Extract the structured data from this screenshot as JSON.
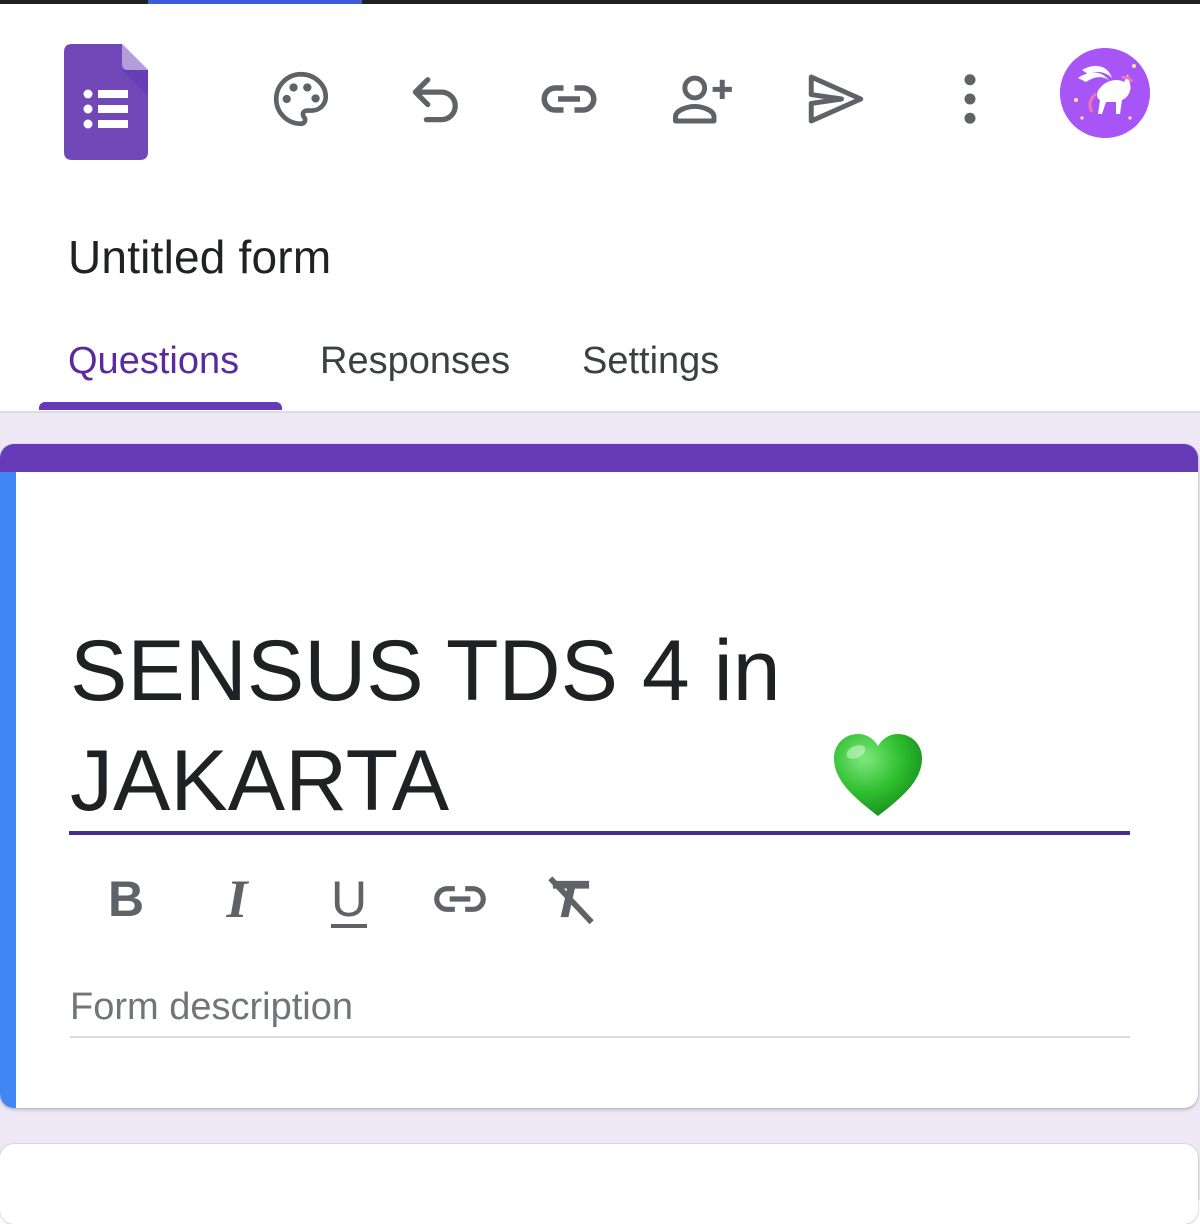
{
  "app": {
    "name": "Google Forms",
    "logo_icon": "google-forms-logo-icon",
    "colors": {
      "theme": "#673ab7",
      "accent": "#4285f4",
      "background": "#ede7f6",
      "active_tab_text": "#5b2a9e",
      "avatar_bg": "#a855f7"
    }
  },
  "toolbar": {
    "buttons": [
      {
        "name": "customize-theme",
        "icon": "palette-icon"
      },
      {
        "name": "undo",
        "icon": "undo-icon"
      },
      {
        "name": "copy-link",
        "icon": "link-icon"
      },
      {
        "name": "add-collaborators",
        "icon": "person-add-icon"
      },
      {
        "name": "send",
        "icon": "send-icon"
      },
      {
        "name": "more-options",
        "icon": "more-vert-icon"
      }
    ],
    "avatar_icon": "pegasus-avatar-icon"
  },
  "form": {
    "document_title": "Untitled form",
    "heading": "SENSUS TDS 4 in JAKARTA",
    "heading_emoji": "💚",
    "description_placeholder": "Form description",
    "description_value": ""
  },
  "tabs": [
    {
      "label": "Questions",
      "active": true
    },
    {
      "label": "Responses",
      "active": false
    },
    {
      "label": "Settings",
      "active": false
    }
  ],
  "formatting_toolbar": [
    {
      "label": "B",
      "icon": "bold-icon"
    },
    {
      "label": "I",
      "icon": "italic-icon"
    },
    {
      "label": "U",
      "icon": "underline-icon"
    },
    {
      "label": "",
      "icon": "link-icon"
    },
    {
      "label": "",
      "icon": "clear-formatting-icon"
    }
  ]
}
